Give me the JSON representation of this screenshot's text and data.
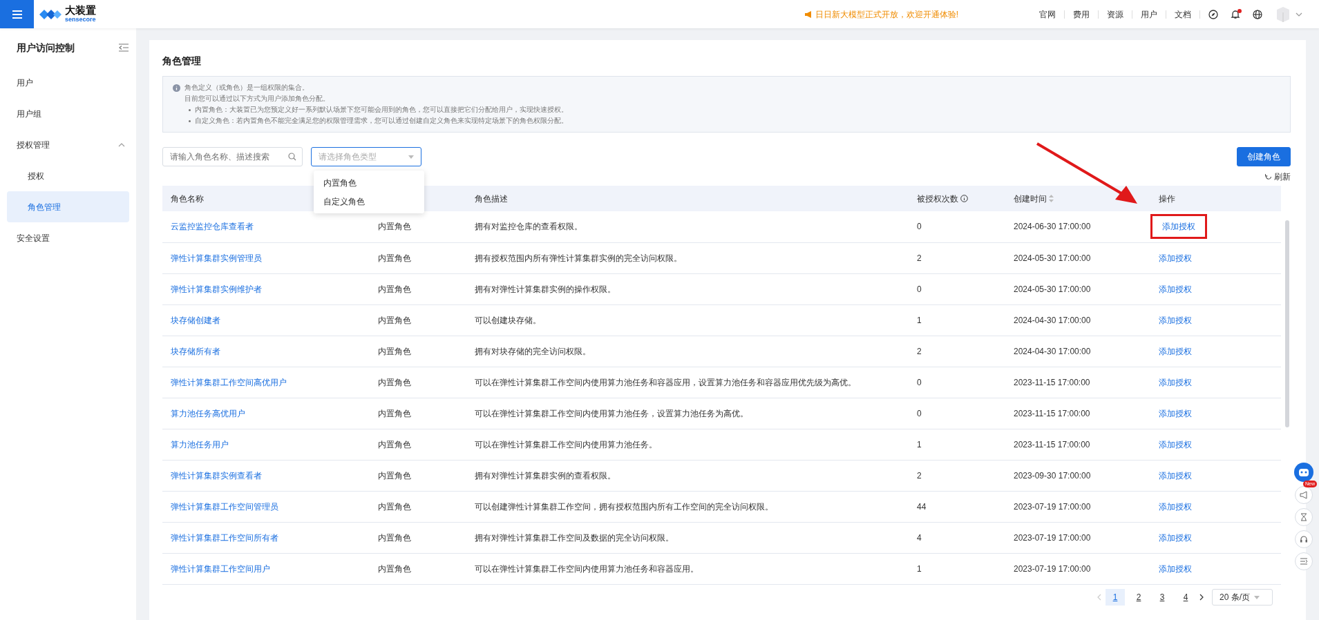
{
  "header": {
    "brand": "大装置",
    "brand_sub": "sensecore",
    "announcement": "日日新大模型正式开放，欢迎开通体验!",
    "links": [
      "官网",
      "费用",
      "资源",
      "用户",
      "文档"
    ],
    "bell_unread": true
  },
  "sidebar": {
    "title": "用户访问控制",
    "items": [
      {
        "label": "用户",
        "selected": false
      },
      {
        "label": "用户组",
        "selected": false
      },
      {
        "label": "授权管理",
        "selected": false,
        "expanded": true,
        "children": [
          {
            "label": "授权",
            "selected": false
          },
          {
            "label": "角色管理",
            "selected": true
          }
        ]
      },
      {
        "label": "安全设置",
        "selected": false
      }
    ]
  },
  "page": {
    "title": "角色管理",
    "info": {
      "lines": [
        "角色定义（或角色）是一组权限的集合。",
        "目前您可以通过以下方式为用户添加角色分配。"
      ],
      "bullets": [
        "内置角色：大装置已为您预定义好一系列默认场景下您可能会用到的角色，您可以直接把它们分配给用户，实现快速授权。",
        "自定义角色：若内置角色不能完全满足您的权限管理需求，您可以通过创建自定义角色来实现特定场景下的角色权限分配。"
      ]
    },
    "search": {
      "placeholder": "请输入角色名称、描述搜索"
    },
    "type_select": {
      "placeholder": "请选择角色类型",
      "expanded": true,
      "options": [
        "内置角色",
        "自定义角色"
      ]
    },
    "create_button": "创建角色",
    "refresh": "刷新"
  },
  "table": {
    "columns": [
      "角色名称",
      "角色描述",
      "被授权次数",
      "创建时间",
      "操作"
    ],
    "rows": [
      {
        "name": "云监控监控仓库查看者",
        "type": "内置角色",
        "description": "拥有对监控仓库的查看权限。",
        "count": "0",
        "created": "2024-06-30 17:00:00",
        "action": "添加授权",
        "highlighted": true
      },
      {
        "name": "弹性计算集群实例管理员",
        "type": "内置角色",
        "description": "拥有授权范围内所有弹性计算集群实例的完全访问权限。",
        "count": "2",
        "created": "2024-05-30 17:00:00",
        "action": "添加授权",
        "highlighted": false
      },
      {
        "name": "弹性计算集群实例维护者",
        "type": "内置角色",
        "description": "拥有对弹性计算集群实例的操作权限。",
        "count": "0",
        "created": "2024-05-30 17:00:00",
        "action": "添加授权",
        "highlighted": false
      },
      {
        "name": "块存储创建者",
        "type": "内置角色",
        "description": "可以创建块存储。",
        "count": "1",
        "created": "2024-04-30 17:00:00",
        "action": "添加授权",
        "highlighted": false
      },
      {
        "name": "块存储所有者",
        "type": "内置角色",
        "description": "拥有对块存储的完全访问权限。",
        "count": "2",
        "created": "2024-04-30 17:00:00",
        "action": "添加授权",
        "highlighted": false
      },
      {
        "name": "弹性计算集群工作空间高优用户",
        "type": "内置角色",
        "description": "可以在弹性计算集群工作空间内使用算力池任务和容器应用，设置算力池任务和容器应用优先级为高优。",
        "count": "0",
        "created": "2023-11-15 17:00:00",
        "action": "添加授权",
        "highlighted": false
      },
      {
        "name": "算力池任务高优用户",
        "type": "内置角色",
        "description": "可以在弹性计算集群工作空间内使用算力池任务，设置算力池任务为高优。",
        "count": "0",
        "created": "2023-11-15 17:00:00",
        "action": "添加授权",
        "highlighted": false
      },
      {
        "name": "算力池任务用户",
        "type": "内置角色",
        "description": "可以在弹性计算集群工作空间内使用算力池任务。",
        "count": "1",
        "created": "2023-11-15 17:00:00",
        "action": "添加授权",
        "highlighted": false
      },
      {
        "name": "弹性计算集群实例查看者",
        "type": "内置角色",
        "description": "拥有对弹性计算集群实例的查看权限。",
        "count": "2",
        "created": "2023-09-30 17:00:00",
        "action": "添加授权",
        "highlighted": false
      },
      {
        "name": "弹性计算集群工作空间管理员",
        "type": "内置角色",
        "description": "可以创建弹性计算集群工作空间，拥有授权范围内所有工作空间的完全访问权限。",
        "count": "44",
        "created": "2023-07-19 17:00:00",
        "action": "添加授权",
        "highlighted": false
      },
      {
        "name": "弹性计算集群工作空间所有者",
        "type": "内置角色",
        "description": "拥有对弹性计算集群工作空间及数据的完全访问权限。",
        "count": "4",
        "created": "2023-07-19 17:00:00",
        "action": "添加授权",
        "highlighted": false
      },
      {
        "name": "弹性计算集群工作空间用户",
        "type": "内置角色",
        "description": "可以在弹性计算集群工作空间内使用算力池任务和容器应用。",
        "count": "1",
        "created": "2023-07-19 17:00:00",
        "action": "添加授权",
        "highlighted": false
      }
    ]
  },
  "pagination": {
    "pages": [
      {
        "label": "1",
        "selected": true
      },
      {
        "label": "2",
        "selected": false
      },
      {
        "label": "3",
        "selected": false
      },
      {
        "label": "4",
        "selected": false
      }
    ],
    "page_size": "20 条/页"
  },
  "float_tools": {
    "new_badge": "New"
  }
}
